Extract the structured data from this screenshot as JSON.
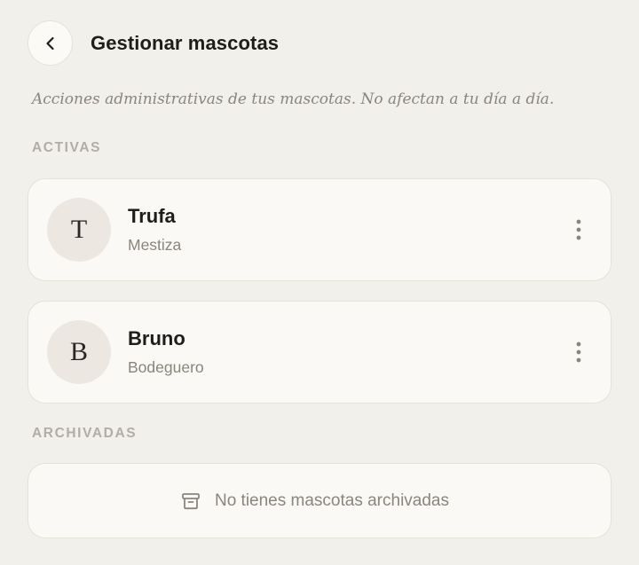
{
  "header": {
    "back_icon": "chevron-left-icon",
    "title": "Gestionar mascotas"
  },
  "subtitle": "Acciones administrativas de tus mascotas. No afectan a tu día a día.",
  "sections": {
    "active": {
      "label": "ACTIVAS",
      "pets": [
        {
          "initial": "T",
          "name": "Trufa",
          "breed": "Mestiza",
          "menu_icon": "more-vertical-icon"
        },
        {
          "initial": "B",
          "name": "Bruno",
          "breed": "Bodeguero",
          "menu_icon": "more-vertical-icon"
        }
      ]
    },
    "archived": {
      "label": "ARCHIVADAS",
      "empty_icon": "archive-icon",
      "empty_text": "No tienes mascotas archivadas"
    }
  },
  "colors": {
    "background": "#f2f0ea",
    "card": "#faf9f5",
    "avatar": "#ece8e1",
    "muted_text": "#8a857d",
    "section_label": "#b2ada4"
  }
}
